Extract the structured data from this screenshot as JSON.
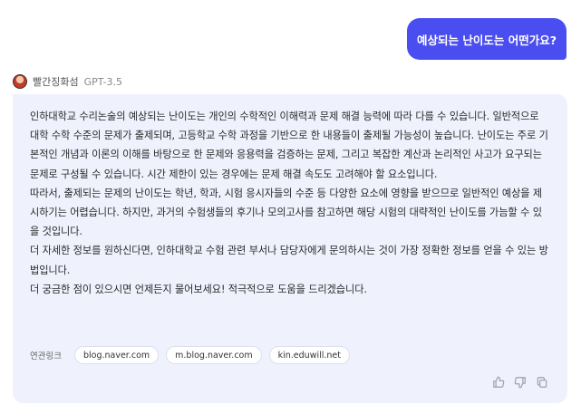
{
  "user_message": "예상되는 난이도는 어떤가요?",
  "bot": {
    "name": "빨간징화섬",
    "model": "GPT-3.5",
    "paragraphs": [
      "인하대학교 수리논술의 예상되는 난이도는 개인의 수학적인 이해력과 문제 해결 능력에 따라 다를 수 있습니다. 일반적으로 대학 수학 수준의 문제가 출제되며, 고등학교 수학 과정을 기반으로 한 내용들이 출제될 가능성이 높습니다. 난이도는 주로 기본적인 개념과 이론의 이해를 바탕으로 한 문제와 응용력을 검증하는 문제, 그리고 복잡한 계산과 논리적인 사고가 요구되는 문제로 구성될 수 있습니다. 시간 제한이 있는 경우에는 문제 해결 속도도 고려해야 할 요소입니다.",
      "따라서, 출제되는 문제의 난이도는 학년, 학과, 시험 응시자들의 수준 등 다양한 요소에 영향을 받으므로 일반적인 예상을 제시하기는 어렵습니다. 하지만, 과거의 수험생들의 후기나 모의고사를 참고하면 해당 시험의 대략적인 난이도를 가늠할 수 있을 것입니다.",
      "더 자세한 정보를 원하신다면, 인하대학교 수험 관련 부서나 담당자에게 문의하시는 것이 가장 정확한 정보를 얻을 수 있는 방법입니다.",
      "더 궁금한 점이 있으시면 언제든지 물어보세요! 적극적으로 도움을 드리겠습니다."
    ]
  },
  "related": {
    "label": "연관링크",
    "links": [
      "blog.naver.com",
      "m.blog.naver.com",
      "kin.eduwill.net"
    ]
  },
  "actions": {
    "like_icon": "thumbs-up-icon",
    "dislike_icon": "thumbs-down-icon",
    "copy_icon": "copy-icon"
  },
  "colors": {
    "user_bubble": "#4a4ef0",
    "answer_bg": "#eff1fd"
  }
}
